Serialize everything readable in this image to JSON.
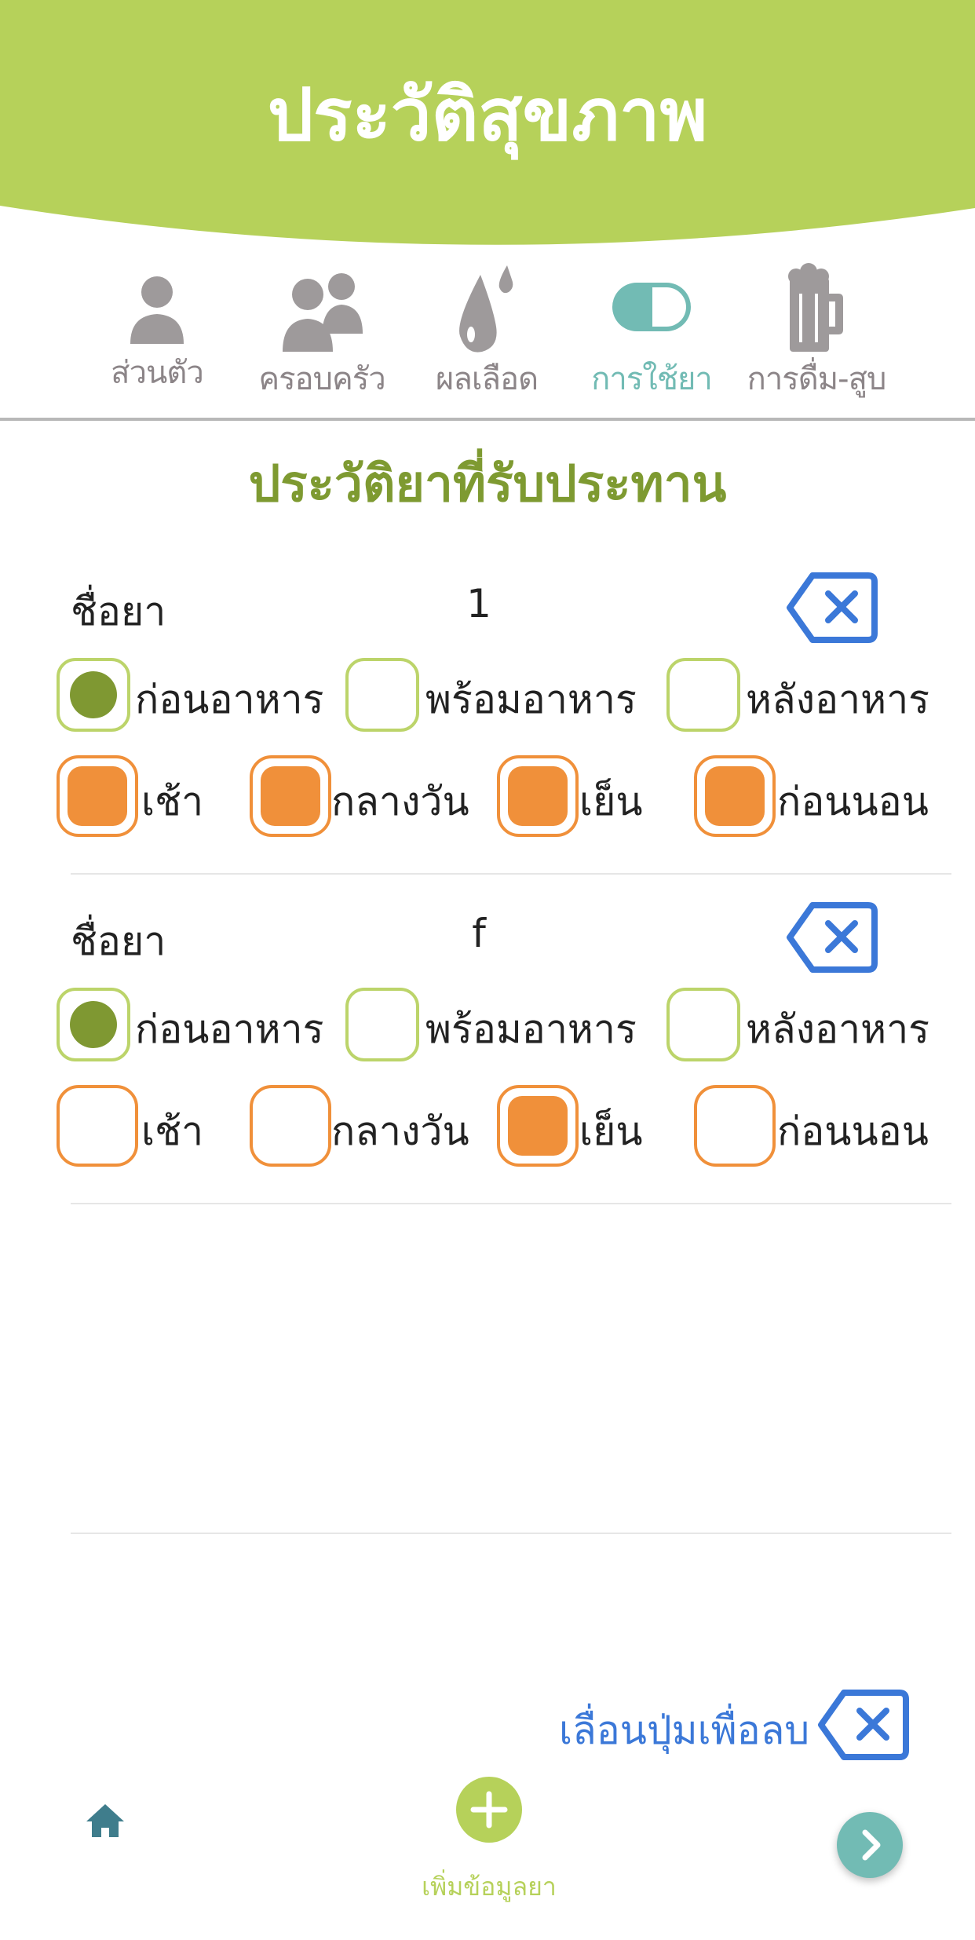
{
  "header": {
    "title": "ประวัติสุขภาพ"
  },
  "colors": {
    "header_green": "#b6d15a",
    "accent_teal": "#72bbb4",
    "title_olive": "#7e9a31",
    "check_orange": "#f0903a",
    "delete_blue": "#3b78d8"
  },
  "tabs": [
    {
      "label": "ส่วนตัว",
      "icon": "person-icon",
      "active": false
    },
    {
      "label": "ครอบครัว",
      "icon": "family-icon",
      "active": false
    },
    {
      "label": "ผลเลือด",
      "icon": "blood-drop-icon",
      "active": false
    },
    {
      "label": "การใช้ยา",
      "icon": "pill-icon",
      "active": true
    },
    {
      "label": "การดื่ม-สูบ",
      "icon": "beer-mug-icon",
      "active": false
    }
  ],
  "section_title": "ประวัติยาที่รับประทาน",
  "medications": [
    {
      "name_label": "ชื่อยา",
      "name": "1",
      "meal_options": [
        {
          "label": "ก่อนอาหาร",
          "checked": true
        },
        {
          "label": "พร้อมอาหาร",
          "checked": false
        },
        {
          "label": "หลังอาหาร",
          "checked": false
        }
      ],
      "time_options": [
        {
          "label": "เช้า",
          "checked": true
        },
        {
          "label": "กลางวัน",
          "checked": true
        },
        {
          "label": "เย็น",
          "checked": true
        },
        {
          "label": "ก่อนนอน",
          "checked": true
        }
      ]
    },
    {
      "name_label": "ชื่อยา",
      "name": "f",
      "meal_options": [
        {
          "label": "ก่อนอาหาร",
          "checked": true
        },
        {
          "label": "พร้อมอาหาร",
          "checked": false
        },
        {
          "label": "หลังอาหาร",
          "checked": false
        }
      ],
      "time_options": [
        {
          "label": "เช้า",
          "checked": false
        },
        {
          "label": "กลางวัน",
          "checked": false
        },
        {
          "label": "เย็น",
          "checked": true
        },
        {
          "label": "ก่อนนอน",
          "checked": false
        }
      ]
    }
  ],
  "swipe_hint": "เลื่อนปุ่มเพื่อลบ",
  "bottom_bar": {
    "home_icon": "home-icon",
    "add_label": "เพิ่มข้อมูลยา",
    "add_icon": "plus-icon",
    "next_icon": "chevron-right-icon"
  }
}
